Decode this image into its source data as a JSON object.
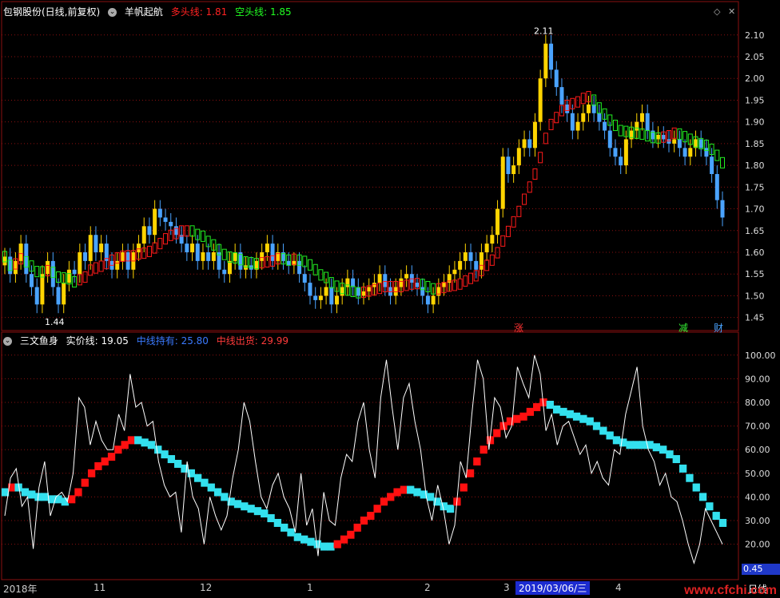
{
  "top_header": {
    "stock": "包钢股份(日线,前复权)",
    "indicator": "羊帆起航",
    "long_label": "多头线: 1.81",
    "short_label": "空头线: 1.85"
  },
  "bottom_header": {
    "indicator": "三文鱼身",
    "real_label": "实价线: 19.05",
    "hold_label": "中线持有: 25.80",
    "exit_label": "中线出货: 29.99"
  },
  "markers": {
    "zhang": "涨",
    "jian": "减",
    "cai": "财"
  },
  "annotations": {
    "high": "2.11",
    "low": "1.44"
  },
  "xaxis": {
    "labels": [
      "2018年",
      "11",
      "12",
      "1",
      "2",
      "3",
      "4"
    ],
    "selected_date": "2019/03/06/三",
    "period": "日线"
  },
  "value_box": "0.45",
  "watermark": "www.cfchi.com",
  "colors": {
    "up": "#ffd400",
    "down": "#4aa3ff",
    "long_band": "#ff1a1a",
    "short_band": "#22ee22",
    "osc_red": "#ff1010",
    "osc_cyan": "#33e0ee",
    "real_line": "#ffffff",
    "grid": "#8a1010"
  },
  "chart_data": [
    {
      "type": "candlestick",
      "title": "羊帆起航",
      "ylim": [
        1.42,
        2.14
      ],
      "yticks": [
        1.45,
        1.5,
        1.55,
        1.6,
        1.65,
        1.7,
        1.75,
        1.8,
        1.85,
        1.9,
        1.95,
        2.0,
        2.05,
        2.1
      ],
      "close": [
        1.59,
        1.55,
        1.58,
        1.62,
        1.55,
        1.52,
        1.48,
        1.55,
        1.58,
        1.52,
        1.48,
        1.53,
        1.56,
        1.55,
        1.6,
        1.58,
        1.64,
        1.6,
        1.62,
        1.58,
        1.56,
        1.58,
        1.6,
        1.56,
        1.6,
        1.62,
        1.66,
        1.64,
        1.7,
        1.68,
        1.67,
        1.66,
        1.64,
        1.62,
        1.6,
        1.62,
        1.58,
        1.6,
        1.58,
        1.6,
        1.56,
        1.55,
        1.58,
        1.6,
        1.56,
        1.57,
        1.56,
        1.58,
        1.6,
        1.62,
        1.58,
        1.6,
        1.58,
        1.57,
        1.58,
        1.55,
        1.53,
        1.5,
        1.49,
        1.5,
        1.52,
        1.48,
        1.5,
        1.52,
        1.54,
        1.52,
        1.5,
        1.51,
        1.52,
        1.53,
        1.55,
        1.52,
        1.5,
        1.52,
        1.54,
        1.55,
        1.53,
        1.52,
        1.5,
        1.48,
        1.5,
        1.52,
        1.53,
        1.55,
        1.56,
        1.58,
        1.6,
        1.58,
        1.56,
        1.6,
        1.62,
        1.64,
        1.7,
        1.82,
        1.78,
        1.8,
        1.84,
        1.86,
        1.84,
        1.9,
        2.0,
        2.08,
        2.02,
        1.98,
        1.94,
        1.92,
        1.88,
        1.9,
        1.92,
        1.94,
        1.92,
        1.9,
        1.88,
        1.84,
        1.82,
        1.8,
        1.86,
        1.88,
        1.9,
        1.92,
        1.88,
        1.86,
        1.87,
        1.86,
        1.85,
        1.86,
        1.84,
        1.82,
        1.84,
        1.86,
        1.84,
        1.82,
        1.78,
        1.72,
        1.68
      ],
      "long_line": 1.81,
      "short_line": 1.85,
      "high_label": 2.11,
      "low_label": 1.44
    },
    {
      "type": "line",
      "title": "三文鱼身",
      "ylim": [
        5,
        105
      ],
      "yticks": [
        20,
        30,
        40,
        50,
        60,
        70,
        80,
        90,
        100
      ],
      "series": [
        {
          "name": "实价线",
          "values": [
            32,
            48,
            52,
            36,
            40,
            18,
            44,
            55,
            32,
            40,
            42,
            38,
            50,
            82,
            78,
            62,
            72,
            64,
            60,
            60,
            75,
            68,
            92,
            78,
            80,
            70,
            72,
            55,
            45,
            40,
            42,
            25,
            55,
            40,
            35,
            20,
            40,
            32,
            26,
            32,
            48,
            60,
            80,
            72,
            55,
            40,
            35,
            45,
            50,
            40,
            35,
            25,
            50,
            28,
            35,
            15,
            42,
            30,
            28,
            48,
            58,
            55,
            72,
            80,
            60,
            48,
            82,
            98,
            78,
            60,
            82,
            88,
            72,
            60,
            40,
            30,
            45,
            35,
            20,
            28,
            55,
            48,
            75,
            98,
            90,
            60,
            82,
            78,
            65,
            70,
            95,
            88,
            82,
            100,
            92,
            68,
            75,
            62,
            70,
            72,
            65,
            58,
            62,
            50,
            55,
            48,
            45,
            60,
            58,
            75,
            85,
            95,
            70,
            60,
            55,
            45,
            50,
            40,
            38,
            30,
            20,
            12,
            20,
            35,
            30,
            25,
            20
          ]
        },
        {
          "name": "中线持有",
          "values": [
            42,
            44,
            44,
            42,
            41,
            40,
            40,
            39,
            39,
            38,
            39,
            42,
            46,
            50,
            53,
            55,
            57,
            60,
            62,
            64,
            64,
            63,
            62,
            60,
            58,
            56,
            54,
            52,
            50,
            48,
            46,
            44,
            42,
            40,
            38,
            37,
            36,
            35,
            34,
            33,
            31,
            29,
            27,
            25,
            23,
            22,
            21,
            20,
            19,
            19,
            20,
            22,
            24,
            27,
            30,
            32,
            35,
            38,
            40,
            42,
            43,
            43,
            42,
            41,
            40,
            38,
            36,
            35,
            38,
            44,
            50,
            55,
            60,
            64,
            67,
            70,
            72,
            73,
            74,
            76,
            78,
            80,
            79,
            77,
            76,
            75,
            74,
            73,
            72,
            70,
            68,
            66,
            64,
            63,
            62,
            62,
            62,
            62,
            61,
            60,
            58,
            56,
            52,
            48,
            44,
            40,
            36,
            32,
            29
          ]
        },
        {
          "name": "中线出货"
        }
      ]
    }
  ]
}
